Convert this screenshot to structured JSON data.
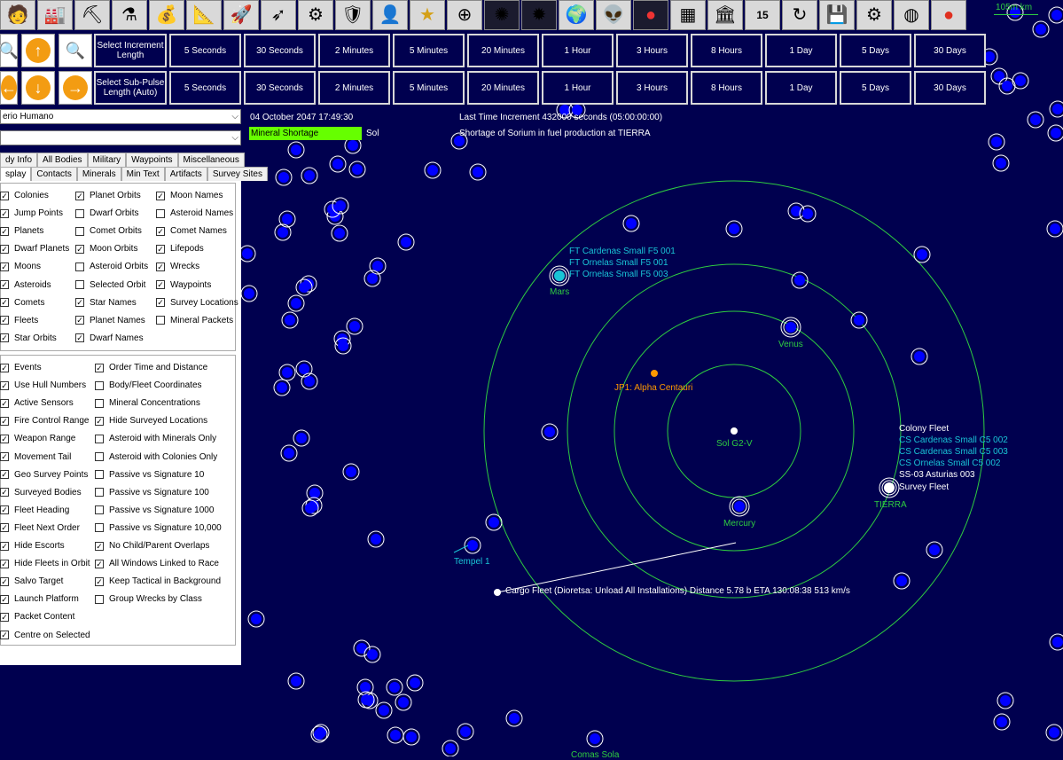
{
  "toolbar": {
    "icons": [
      "population-icon",
      "industry-icon",
      "mining-icon",
      "research-icon",
      "wealth-icon",
      "design-icon",
      "ship-icon",
      "missile-icon",
      "turret-icon",
      "ground-unit-icon",
      "commander-icon",
      "medal-icon",
      "flag-uk-icon",
      "galaxy-icon",
      "spiral-galaxy-icon",
      "planet-icon",
      "alien-icon",
      "moon-icon",
      "circuit-icon",
      "government-icon",
      "calendar-icon",
      "refresh-icon",
      "save-icon",
      "gear-icon",
      "globe-icon",
      "red-ball-icon"
    ],
    "calendar_day": "15"
  },
  "increment": {
    "label": "Select Increment Length",
    "options": [
      "5 Seconds",
      "30 Seconds",
      "2 Minutes",
      "5 Minutes",
      "20 Minutes",
      "1 Hour",
      "3 Hours",
      "8 Hours",
      "1 Day",
      "5 Days",
      "30 Days"
    ]
  },
  "subpulse": {
    "label": "Select Sub-Pulse Length (Auto)",
    "options": [
      "5 Seconds",
      "30 Seconds",
      "2 Minutes",
      "5 Minutes",
      "20 Minutes",
      "1 Hour",
      "3 Hours",
      "8 Hours",
      "1 Day",
      "5 Days",
      "30 Days"
    ]
  },
  "scale": "105m km",
  "race_select": "erio Humano",
  "system_select": "",
  "tabs_row1": [
    "dy Info",
    "All Bodies",
    "Military",
    "Waypoints",
    "Miscellaneous"
  ],
  "tabs_row2": [
    "splay",
    "Contacts",
    "Minerals",
    "Min Text",
    "Artifacts",
    "Survey Sites"
  ],
  "display_options": {
    "col1": [
      {
        "label": "Colonies",
        "checked": true
      },
      {
        "label": "Jump Points",
        "checked": true
      },
      {
        "label": "Planets",
        "checked": true
      },
      {
        "label": "Dwarf Planets",
        "checked": true
      },
      {
        "label": "Moons",
        "checked": true
      },
      {
        "label": "Asteroids",
        "checked": true
      },
      {
        "label": "Comets",
        "checked": true
      },
      {
        "label": "Fleets",
        "checked": true
      },
      {
        "label": "Star Orbits",
        "checked": true
      }
    ],
    "col2": [
      {
        "label": "Planet Orbits",
        "checked": true
      },
      {
        "label": "Dwarf Orbits",
        "checked": false
      },
      {
        "label": "Comet Orbits",
        "checked": false
      },
      {
        "label": "Moon Orbits",
        "checked": true
      },
      {
        "label": "Asteroid Orbits",
        "checked": false
      },
      {
        "label": "Selected Orbit",
        "checked": false
      },
      {
        "label": "Star Names",
        "checked": true
      },
      {
        "label": "Planet Names",
        "checked": true
      },
      {
        "label": "Dwarf Names",
        "checked": true
      }
    ],
    "col3": [
      {
        "label": "Moon Names",
        "checked": true
      },
      {
        "label": "Asteroid Names",
        "checked": false
      },
      {
        "label": "Comet Names",
        "checked": true
      },
      {
        "label": "Lifepods",
        "checked": true
      },
      {
        "label": "Wrecks",
        "checked": true
      },
      {
        "label": "Waypoints",
        "checked": true
      },
      {
        "label": "Survey Locations",
        "checked": true
      },
      {
        "label": "Mineral Packets",
        "checked": false
      }
    ]
  },
  "misc_options": {
    "col1": [
      {
        "label": "Events",
        "checked": true
      },
      {
        "label": "Use Hull Numbers",
        "checked": true
      },
      {
        "label": "Active Sensors",
        "checked": true
      },
      {
        "label": "Fire Control Range",
        "checked": true
      },
      {
        "label": "Weapon Range",
        "checked": true
      },
      {
        "label": "Movement Tail",
        "checked": true
      },
      {
        "label": "Geo Survey Points",
        "checked": true
      },
      {
        "label": "Surveyed Bodies",
        "checked": true
      },
      {
        "label": "Fleet Heading",
        "checked": true
      },
      {
        "label": "Fleet Next Order",
        "checked": true
      },
      {
        "label": "Hide Escorts",
        "checked": true
      },
      {
        "label": "Hide Fleets in Orbit",
        "checked": true
      },
      {
        "label": "Salvo Target",
        "checked": true
      },
      {
        "label": "Launch Platform",
        "checked": true
      },
      {
        "label": "Packet Content",
        "checked": true
      },
      {
        "label": "Centre on Selected",
        "checked": true
      }
    ],
    "col2": [
      {
        "label": "Order Time and Distance",
        "checked": true
      },
      {
        "label": "Body/Fleet Coordinates",
        "checked": false
      },
      {
        "label": "Mineral Concentrations",
        "checked": false
      },
      {
        "label": "Hide Surveyed Locations",
        "checked": true
      },
      {
        "label": "Asteroid with Minerals Only",
        "checked": false
      },
      {
        "label": "Asteroid with Colonies Only",
        "checked": false
      },
      {
        "label": "Passive vs Signature 10",
        "checked": false
      },
      {
        "label": "Passive vs Signature 100",
        "checked": false
      },
      {
        "label": "Passive vs Signature 1000",
        "checked": false
      },
      {
        "label": "Passive vs Signature 10,000",
        "checked": false
      },
      {
        "label": "No Child/Parent Overlaps",
        "checked": true
      },
      {
        "label": "All Windows Linked to Race",
        "checked": true
      },
      {
        "label": "Keep Tactical in Background",
        "checked": true
      },
      {
        "label": "Group Wrecks by Class",
        "checked": false
      }
    ]
  },
  "status": {
    "date": "04 October 2047 17:49:30",
    "last_increment": "Last Time Increment 432000 seconds (05:00:00:00)",
    "event_type": "Mineral Shortage",
    "event_system": "Sol",
    "event_text": "Shortage of Sorium in fuel production at TIERRA"
  },
  "map_labels": {
    "mars_fleets": [
      "FT Cardenas Small F5 001",
      "FT Ornelas Small F5 001",
      "FT Ornelas Small F5 003"
    ],
    "mars": "Mars",
    "venus": "Venus",
    "jump_point": "JP1: Alpha Centauri",
    "sun": "Sol G2-V",
    "mercury": "Mercury",
    "tierra": "TIERRA",
    "tierra_fleets_white1": "Colony Fleet",
    "tierra_fleets_cyan": [
      "CS Cardenas Small C5 002",
      "CS Cardenas Small C5 003",
      "CS Ornelas Small C5 002"
    ],
    "tierra_fleets_white2": [
      "SS-03 Asturias 003",
      "Survey Fleet"
    ],
    "tempel": "Tempel 1",
    "cargo_fleet": "Cargo Fleet  (Dioretsa: Unload All Installations)   Distance 5.78 b   ETA 130:08:38   513 km/s",
    "comet_bottom": "Comas Sola"
  },
  "colors": {
    "background": "#00004f",
    "orbit": "#2ecc40",
    "body": "#0000ff",
    "alert": "#66ff00",
    "fleet_text": "#19c4d6",
    "jump_point": "#ff9900"
  }
}
